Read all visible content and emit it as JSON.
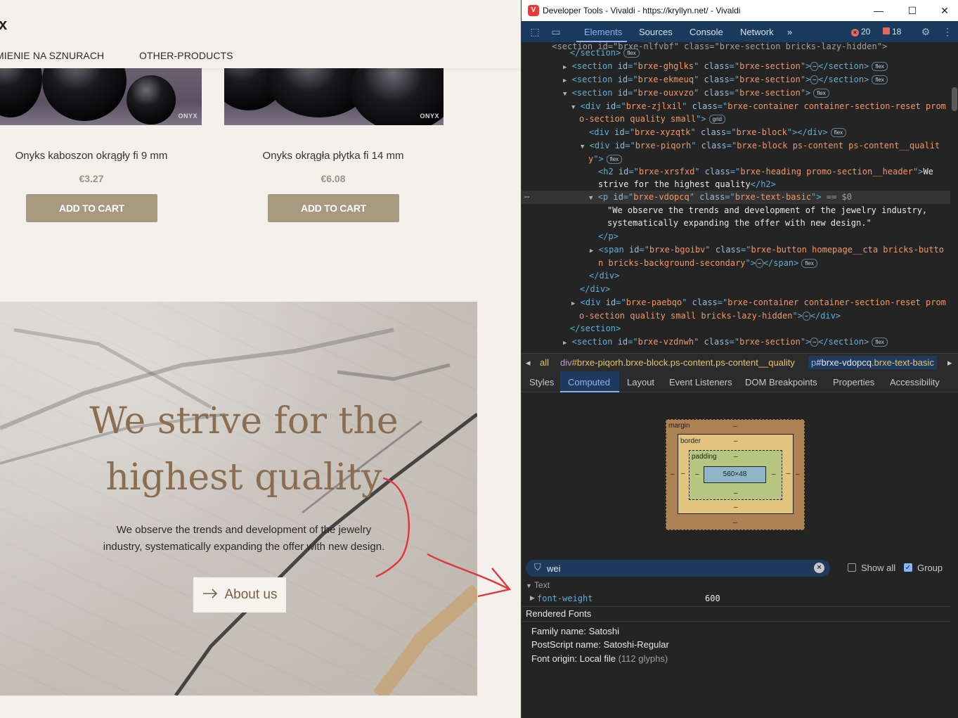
{
  "site": {
    "logo_fragment": "x",
    "nav": [
      "MIENIE NA SZNURACH",
      "OTHER-PRODUCTS"
    ],
    "watermark": "ONYX",
    "products": [
      {
        "name": "Onyks kaboszon okrągły fi 9 mm",
        "price": "€3.27",
        "button": "ADD TO CART"
      },
      {
        "name": "Onyks okrągła płytka fi 14 mm",
        "price": "€6.08",
        "button": "ADD TO CART"
      }
    ],
    "hero": {
      "title_line1": "We strive for the",
      "title_line2": "highest quality",
      "text_line1": "We observe the trends and development of the jewelry",
      "text_line2": "industry, systematically expanding the offer with new design.",
      "button_label": "About us",
      "button_icon": "arrow-right-icon"
    },
    "annotation_color": "#e0353a"
  },
  "devtools": {
    "window_title": "Developer Tools - Vivaldi - https://kryllyn.net/ - Vivaldi",
    "tabs": [
      "Elements",
      "Sources",
      "Console",
      "Network"
    ],
    "active_tab": "Elements",
    "error_count": "20",
    "warning_count": "18",
    "breadcrumb": {
      "first": "all",
      "second_tag": "div",
      "second_sel": "#brxe-piqorh.brxe-block.ps-content.ps-content__quality",
      "third_tag": "p",
      "third_id": "#brxe-vdopcq",
      "third_cls": ".brxe-text-basic"
    },
    "subtabs": [
      "Styles",
      "Computed",
      "Layout",
      "Event Listeners",
      "DOM Breakpoints",
      "Properties",
      "Accessibility"
    ],
    "active_subtab": "Computed",
    "box_model": {
      "margin_label": "margin",
      "border_label": "border",
      "padding_label": "padding",
      "content_size": "560×48",
      "dash": "–"
    },
    "filter": {
      "value": "wei",
      "show_all_label": "Show all",
      "show_all_checked": false,
      "group_label": "Group",
      "group_checked": true
    },
    "computed": {
      "group": "Text",
      "property": "font-weight",
      "value": "600"
    },
    "rendered_fonts": {
      "header": "Rendered Fonts",
      "family": "Family name: Satoshi",
      "postscript": "PostScript name: Satoshi-Regular",
      "origin": "Font origin: Local file",
      "glyphs": "(112 glyphs)"
    },
    "dom": {
      "section_close": "</section>",
      "sec_ghglks": "brxe-ghglks",
      "sec_ekmeuq": "brxe-ekmeuq",
      "sec_ouxvzo": "brxe-ouxvzo",
      "sec_cls": "brxe-section",
      "div_zjlxil": "brxe-zjlxil",
      "div_zjlxil_cls_a": "brxe-container container-section-reset prom",
      "div_zjlxil_cls_b": "o-section quality small",
      "div_xyzqtk": "brxe-xyzqtk",
      "block_cls": "brxe-block",
      "div_piqorh": "brxe-piqorh",
      "piqorh_cls_a": "brxe-block ps-content ps-content__qualit",
      "piqorh_cls_b": "y",
      "h2_id": "brxe-xrsfxd",
      "h2_cls": "brxe-heading promo-section__header",
      "h2_text_a": "We",
      "h2_text_b": "strive for the highest quality",
      "p_id": "brxe-vdopcq",
      "p_cls": "brxe-text-basic",
      "p_marker": "== $0",
      "p_text_a": "\"We observe the trends and development of the jewelry industry,",
      "p_text_b": "systematically expanding the offer with new design.\"",
      "span_id": "brxe-bgoibv",
      "span_cls_a": "brxe-button homepage__cta bricks-butto",
      "span_cls_b": "n bricks-background-secondary",
      "div_paebqo": "brxe-paebqo",
      "paebqo_cls_a": "brxe-container container-section-reset prom",
      "paebqo_cls_b": "o-section quality small bricks-lazy-hidden",
      "sec_vzdnwh": "brxe-vzdnwh",
      "chip_flex": "flex",
      "chip_grid": "grid"
    }
  }
}
